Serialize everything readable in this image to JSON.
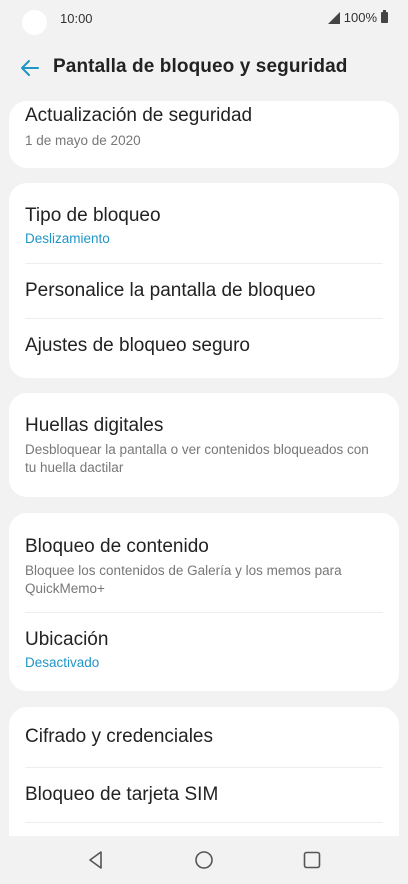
{
  "status": {
    "time": "10:00",
    "battery": "100%"
  },
  "header": {
    "title": "Pantalla de bloqueo y seguridad"
  },
  "cards": {
    "c0": {
      "security_update_label": "Actualización de seguridad",
      "security_update_value": "1 de mayo de 2020"
    },
    "c1": {
      "lock_type_label": "Tipo de bloqueo",
      "lock_type_value": "Deslizamiento",
      "customize_label": "Personalice la pantalla de bloqueo",
      "secure_lock_label": "Ajustes de bloqueo seguro"
    },
    "c2": {
      "fingerprints_label": "Huellas digitales",
      "fingerprints_desc": "Desbloquear la pantalla o ver contenidos bloqueados con tu huella dactilar"
    },
    "c3": {
      "content_lock_label": "Bloqueo de contenido",
      "content_lock_desc": "Bloquee los contenidos de Galería y los memos para QuickMemo+",
      "location_label": "Ubicación",
      "location_value": "Desactivado"
    },
    "c4": {
      "encryption_label": "Cifrado y credenciales",
      "sim_lock_label": "Bloqueo de tarjeta SIM"
    }
  },
  "colors": {
    "accent": "#1f95c8",
    "background": "#f2f2f2",
    "card": "#ffffff"
  },
  "navbar": {
    "icons": [
      "back-triangle-icon",
      "home-circle-icon",
      "recents-square-icon"
    ]
  }
}
